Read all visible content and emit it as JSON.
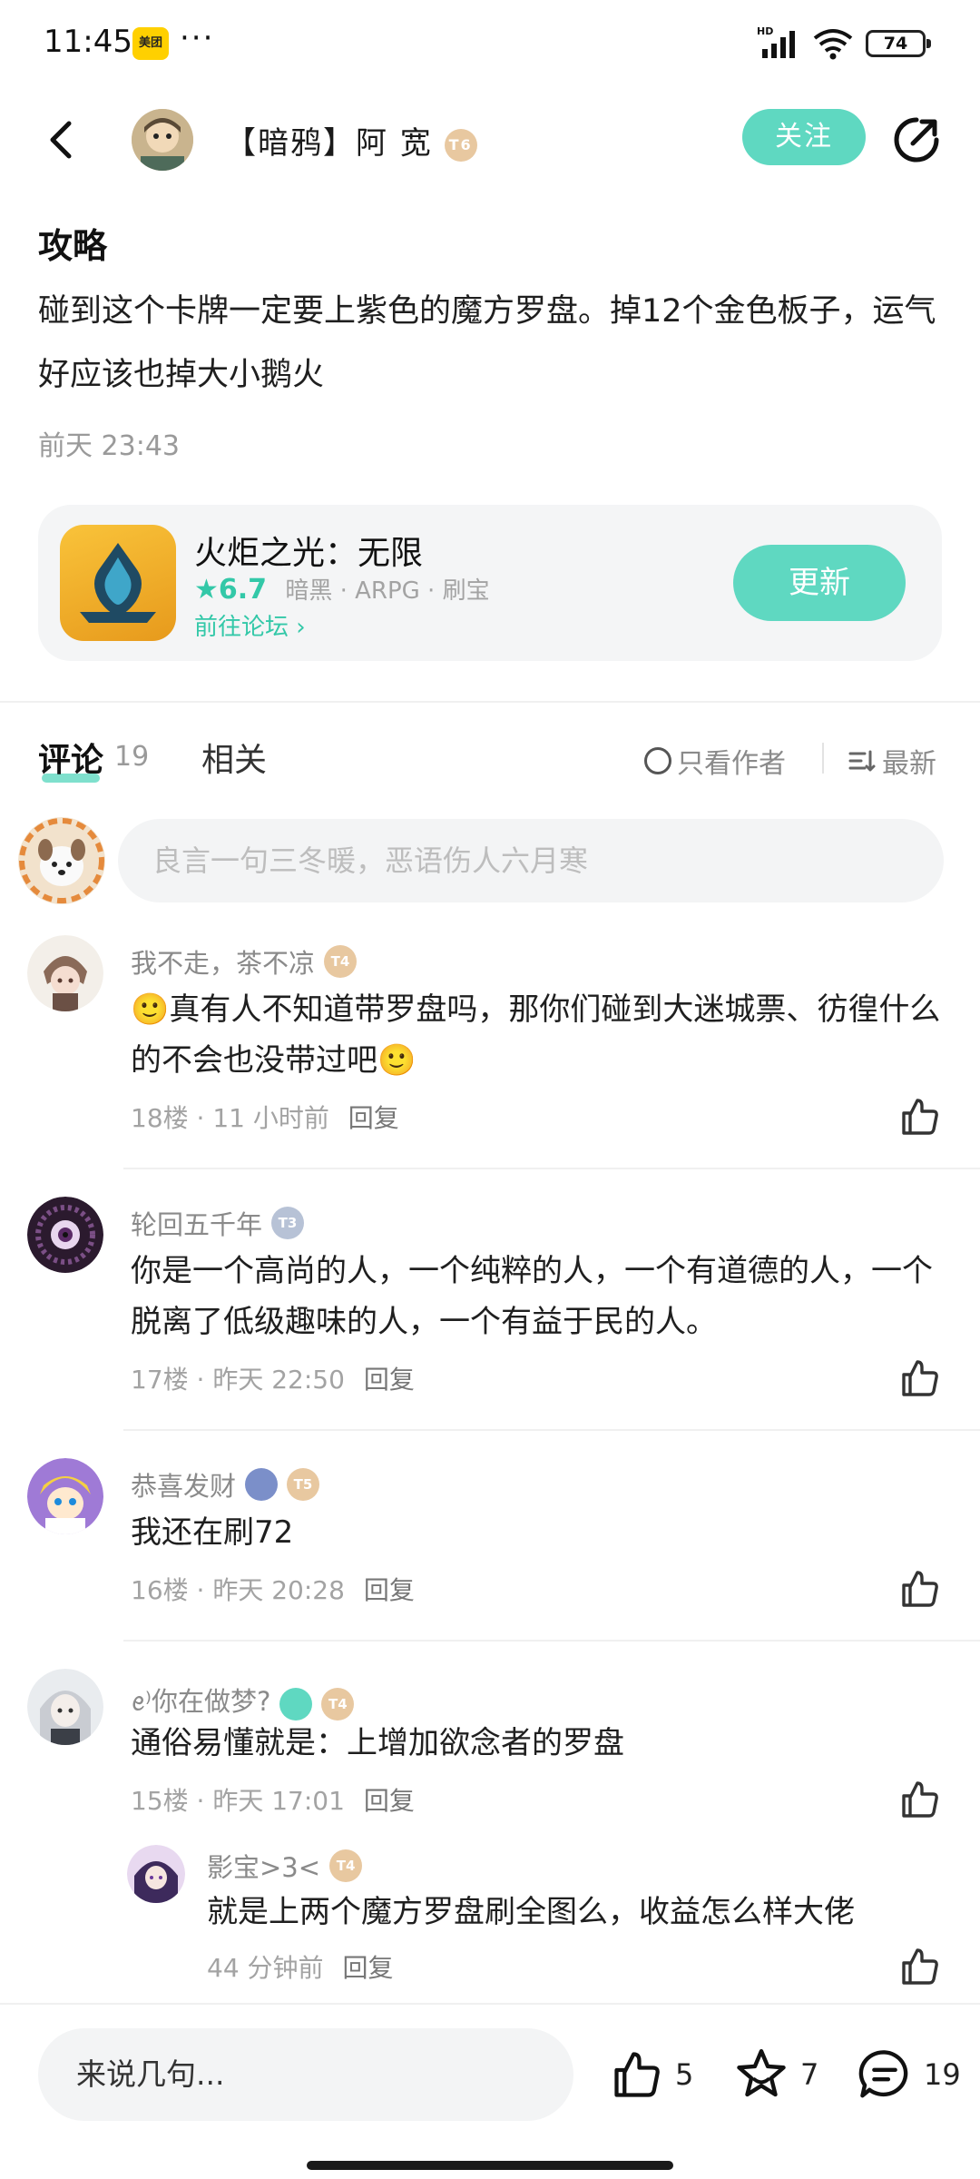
{
  "status_bar": {
    "time": "11:45",
    "app_badge": "美团",
    "more": "···",
    "hd": "HD",
    "battery": "74"
  },
  "header": {
    "author_name": "【暗鸦】阿 宽",
    "author_level": "T6",
    "follow_label": "关注"
  },
  "post": {
    "tag": "攻略",
    "body": "碰到这个卡牌一定要上紫色的魔方罗盘。掉12个金色板子，运气好应该也掉大小鹅火",
    "time": "前天 23:43"
  },
  "game_card": {
    "name": "火炬之光：无限",
    "rating": "★6.7",
    "tags": "暗黑 · ARPG · 刷宝",
    "forum_link": "前往论坛 ›",
    "update_label": "更新"
  },
  "tabs": {
    "comments_label": "评论",
    "comments_count": "19",
    "related_label": "相关",
    "only_author_label": "只看作者",
    "sort_label": "最新"
  },
  "comment_input": {
    "placeholder": "良言一句三冬暖，恶语伤人六月寒"
  },
  "comments": [
    {
      "name": "我不走，茶不凉",
      "level": "T4",
      "text": "🙂真有人不知道带罗盘吗，那你们碰到大迷城票、彷徨什么的不会也没带过吧🙂",
      "floor": "18楼 · 11 小时前",
      "reply": "回复"
    },
    {
      "name": "轮回五千年",
      "level": "T3",
      "text": "你是一个高尚的人，一个纯粹的人，一个有道德的人，一个脱离了低级趣味的人，一个有益于民的人。",
      "floor": "17楼 · 昨天 22:50",
      "reply": "回复"
    },
    {
      "name": "恭喜发财",
      "level": "T5",
      "text": "我还在刷72",
      "floor": "16楼 · 昨天 20:28",
      "reply": "回复"
    },
    {
      "name": "ꫀ⁾你在做梦?",
      "level": "T4",
      "text": "通俗易懂就是：上增加欲念者的罗盘",
      "floor": "15楼 · 昨天 17:01",
      "reply": "回复"
    }
  ],
  "sub_reply": {
    "name": "影宝>3<",
    "level": "T4",
    "text": "就是上两个魔方罗盘刷全图么，收益怎么样大佬",
    "floor": "44 分钟前",
    "reply": "回复"
  },
  "bottom_bar": {
    "say_placeholder": "来说几句...",
    "likes": "5",
    "favorites": "7",
    "comments": "19"
  },
  "colors": {
    "accent": "#5fd8c1",
    "rating": "#33c8a8",
    "muted": "#9a9a9a"
  }
}
